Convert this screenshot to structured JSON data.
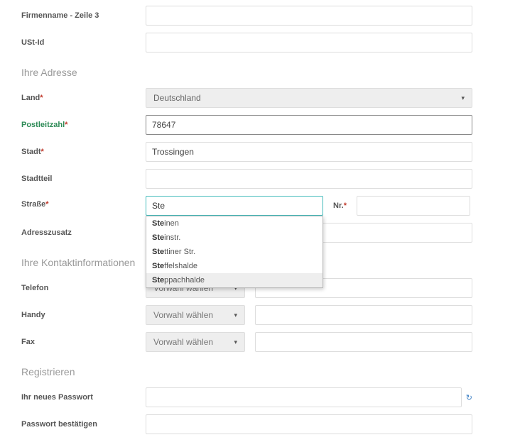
{
  "labels": {
    "company_line3": "Firmenname - Zeile 3",
    "vat_id": "USt-Id",
    "section_address": "Ihre Adresse",
    "country": "Land",
    "zip": "Postleitzahl",
    "city": "Stadt",
    "district": "Stadtteil",
    "street": "Straße",
    "nr": "Nr.",
    "addr_suffix": "Adresszusatz",
    "section_contact": "Ihre Kontaktinformationen",
    "phone": "Telefon",
    "mobile": "Handy",
    "fax": "Fax",
    "section_register": "Registrieren",
    "new_password": "Ihr neues Passwort",
    "confirm_password": "Passwort bestätigen",
    "prefix_placeholder": "Vorwahl wählen"
  },
  "values": {
    "country": "Deutschland",
    "zip": "78647",
    "city": "Trossingen",
    "street": "Ste"
  },
  "autocomplete": {
    "prefix": "Ste",
    "items": [
      "inen",
      "instr.",
      "ttiner Str.",
      "ffelshalde",
      "ppachhalde"
    ],
    "selected_index": 4
  }
}
